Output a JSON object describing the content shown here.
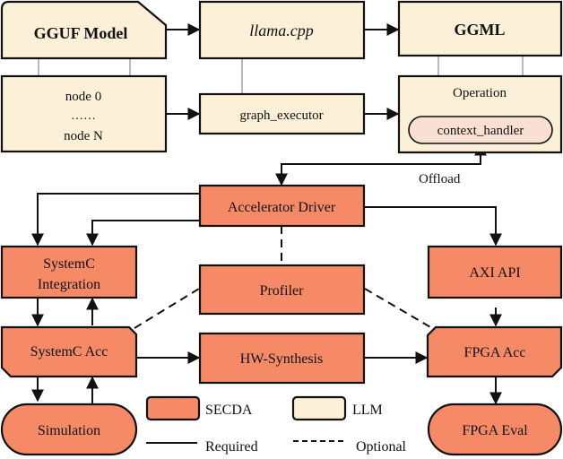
{
  "diagram": {
    "nodes": {
      "gguf_model": {
        "label": "GGUF Model",
        "group": "LLM"
      },
      "llama_cpp": {
        "label": "llama.cpp",
        "group": "LLM"
      },
      "ggml": {
        "label": "GGML",
        "group": "LLM"
      },
      "nodes_box": {
        "line1": "node 0",
        "line2": "……",
        "line3": "node N",
        "group": "LLM"
      },
      "graph_executor": {
        "label": "graph_executor",
        "group": "LLM"
      },
      "operation": {
        "label": "Operation",
        "group": "LLM"
      },
      "context_handler": {
        "label": "context_handler"
      },
      "accelerator_driver": {
        "label": "Accelerator Driver",
        "group": "SECDA"
      },
      "systemc_integration": {
        "line1": "SystemC",
        "line2": "Integration",
        "group": "SECDA"
      },
      "profiler": {
        "label": "Profiler",
        "group": "SECDA"
      },
      "axi_api": {
        "label": "AXI API",
        "group": "SECDA"
      },
      "systemc_acc": {
        "label": "SystemC Acc",
        "group": "SECDA"
      },
      "hw_synthesis": {
        "label": "HW-Synthesis",
        "group": "SECDA"
      },
      "fpga_acc": {
        "label": "FPGA Acc",
        "group": "SECDA"
      },
      "simulation": {
        "label": "Simulation",
        "group": "SECDA"
      },
      "fpga_eval": {
        "label": "FPGA Eval",
        "group": "SECDA"
      }
    },
    "edge_labels": {
      "offload": "Offload"
    },
    "legend": {
      "secda": "SECDA",
      "llm": "LLM",
      "required": "Required",
      "optional": "Optional"
    },
    "colors": {
      "secda": "#f68a67",
      "llm": "#fdf0d8",
      "context_handler": "#f9e0d3"
    }
  }
}
